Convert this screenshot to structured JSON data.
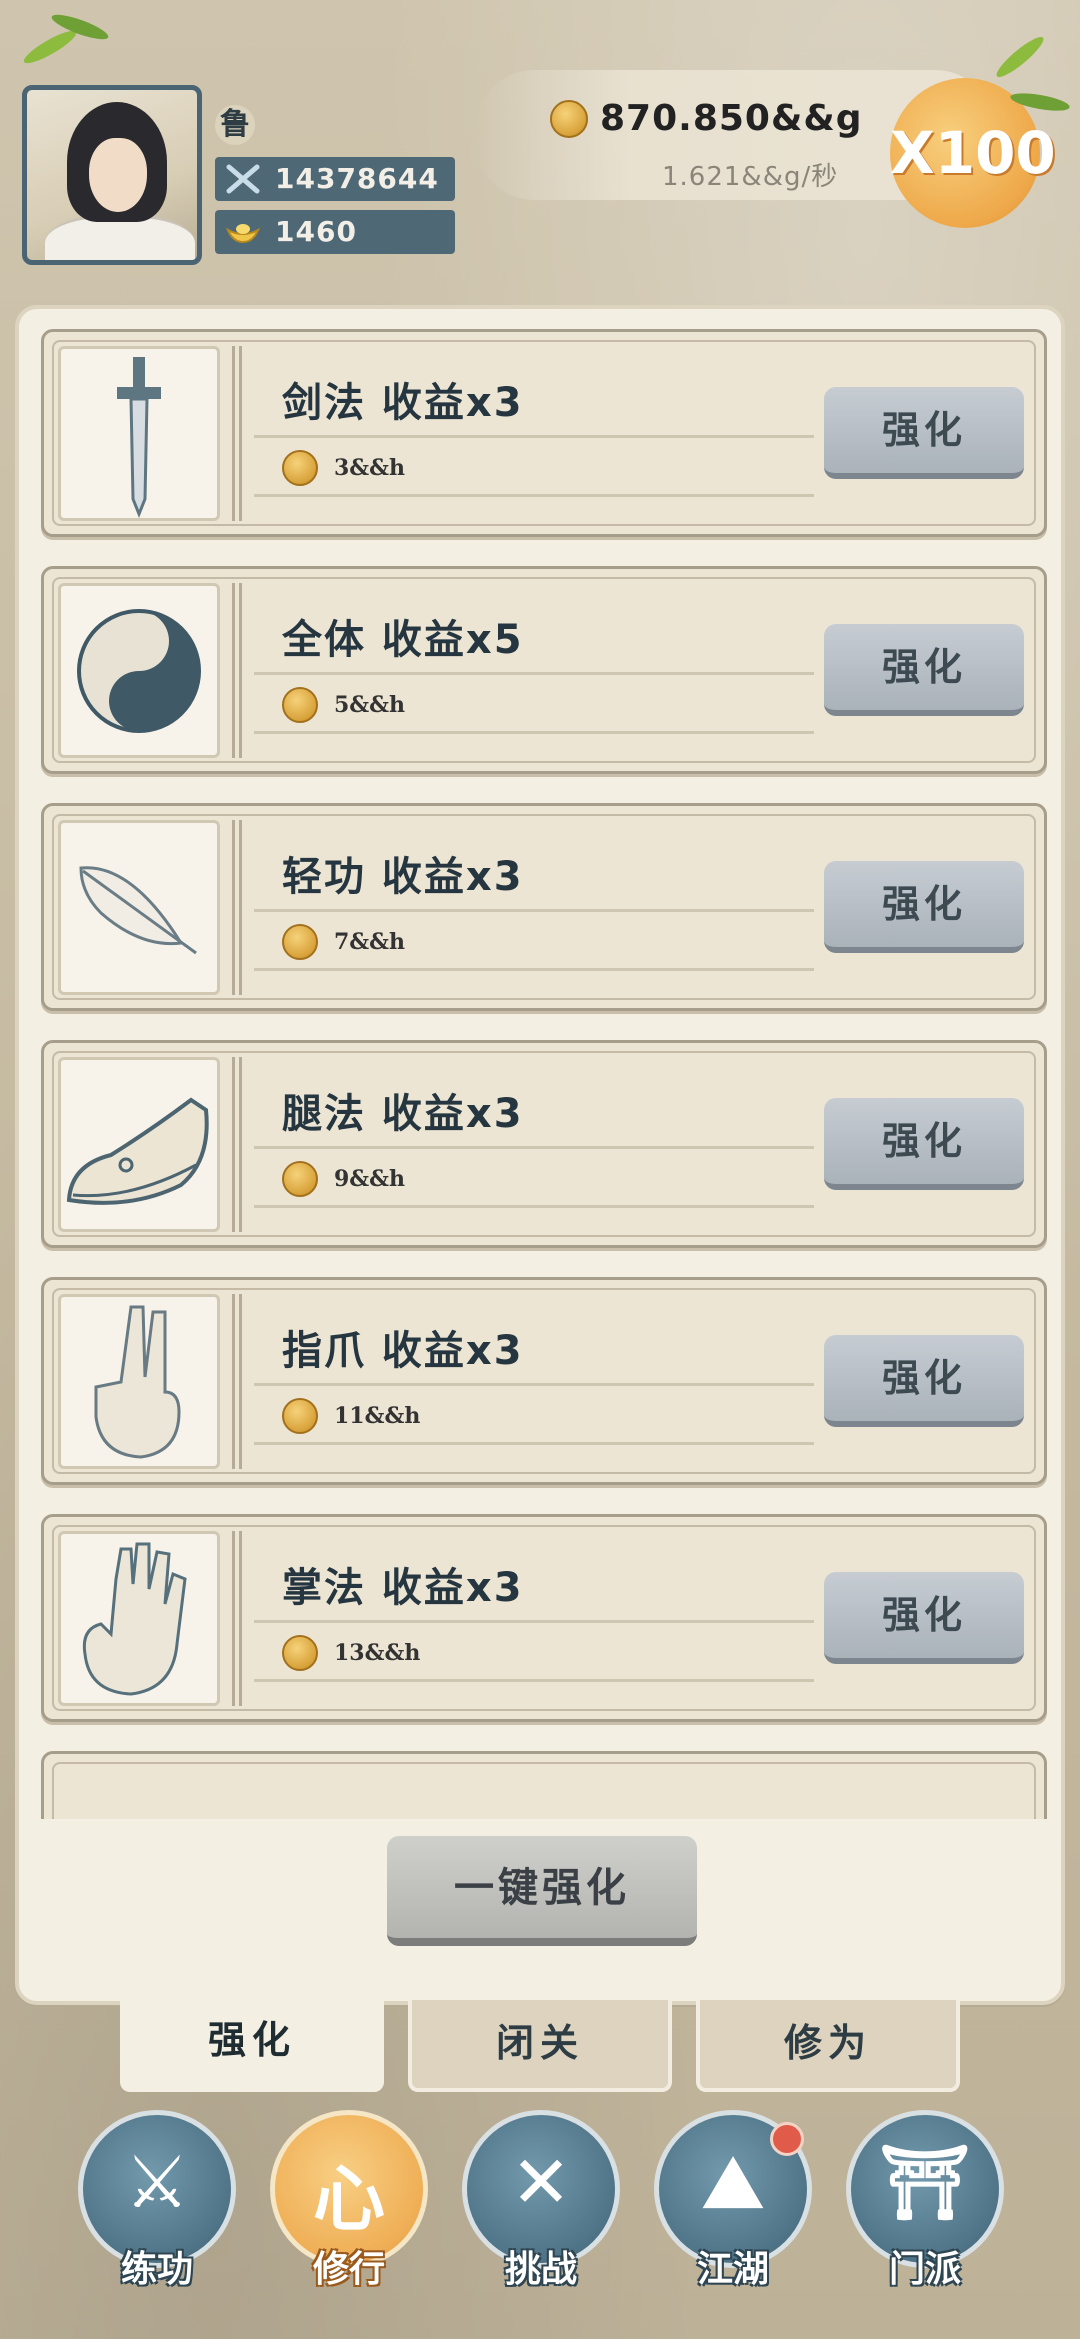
{
  "player": {
    "name": "鲁",
    "power": "14378644",
    "ingots": "1460"
  },
  "currency": {
    "amount": "870.850&&g",
    "rate": "1.621&&g/秒",
    "multiplier": "X100"
  },
  "upgrades": [
    {
      "title": "剑法 收益x3",
      "cost": "3&&h",
      "button": "强化",
      "icon": "sword-icon"
    },
    {
      "title": "全体 收益x5",
      "cost": "5&&h",
      "button": "强化",
      "icon": "yin-yang-icon"
    },
    {
      "title": "轻功 收益x3",
      "cost": "7&&h",
      "button": "强化",
      "icon": "feather-icon"
    },
    {
      "title": "腿法 收益x3",
      "cost": "9&&h",
      "button": "强化",
      "icon": "shoe-icon"
    },
    {
      "title": "指爪 收益x3",
      "cost": "11&&h",
      "button": "强化",
      "icon": "two-finger-hand-icon"
    },
    {
      "title": "掌法 收益x3",
      "cost": "13&&h",
      "button": "强化",
      "icon": "palm-icon"
    }
  ],
  "one_key": "一键强化",
  "tabs": [
    "强化",
    "闭关",
    "修为"
  ],
  "nav": [
    {
      "label": "练功",
      "glyph": "⚔"
    },
    {
      "label": "修行",
      "glyph": "心"
    },
    {
      "label": "挑战",
      "glyph": "✕"
    },
    {
      "label": "江湖",
      "glyph": "⛰"
    },
    {
      "label": "门派",
      "glyph": "⛩"
    }
  ],
  "colors": {
    "accent": "#efae55",
    "nav": "#4f7487",
    "panel": "#f4efe3"
  }
}
